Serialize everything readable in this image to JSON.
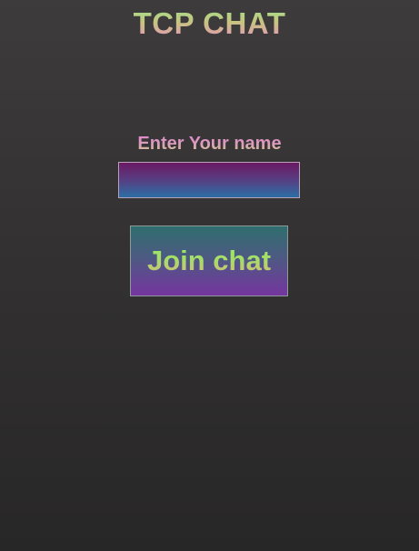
{
  "app": {
    "title": "TCP CHAT"
  },
  "join_form": {
    "name_label": "Enter Your name",
    "name_input_value": "",
    "name_input_placeholder": "",
    "join_button_label": "Join chat"
  },
  "colors": {
    "background_top": "#3d3b3b",
    "background_bottom": "#282727",
    "input_gradient_top": "#6a1a63",
    "input_gradient_bottom": "#2c6ea4",
    "button_gradient_top": "#2f6e6e",
    "button_gradient_bottom": "#74359f",
    "title_text_green": "#9ce38d",
    "title_text_pink": "#e98fc0",
    "button_text_green": "#93ea61"
  }
}
